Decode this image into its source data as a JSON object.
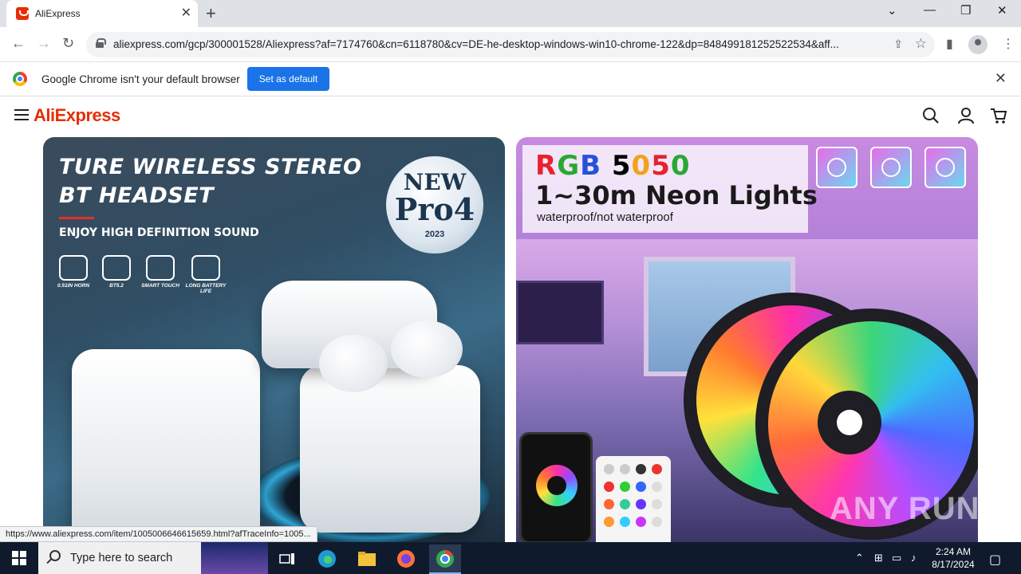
{
  "browser": {
    "tab_title": "AliExpress",
    "tab_close": "✕",
    "new_tab": "+",
    "url": "aliexpress.com/gcp/300001528/Aliexpress?af=7174760&cn=6118780&cv=DE-he-desktop-windows-win10-chrome-122&dp=848499181252522534&aff...",
    "window_controls": {
      "minimize": "—",
      "restore": "❐",
      "close": "✕",
      "tab_search": "⌄"
    }
  },
  "infobar": {
    "message": "Google Chrome isn't your default browser",
    "button": "Set as default",
    "close": "✕"
  },
  "site": {
    "logo": "AliExpress",
    "icons": [
      "menu-icon",
      "search-icon",
      "account-icon",
      "cart-icon"
    ]
  },
  "banner1": {
    "headline1": "TURE WIRELESS STEREO",
    "headline2": "BT HEADSET",
    "subline": "ENJOY HIGH DEFINITION SOUND",
    "badge_line1": "NEW",
    "badge_line2": "Pro4",
    "badge_year": "2023",
    "features": [
      "0.51IN HORN",
      "BT5.2",
      "SMART TOUCH",
      "LONG BATTERY LIFE"
    ]
  },
  "banner2": {
    "rgb_text": "RGB 5050",
    "headline": "1~30m Neon Lights",
    "subline": "waterproof/not waterproof",
    "icons": [
      "brightness-icon",
      "diy-icon",
      "timer-icon"
    ]
  },
  "status_url": "https://www.aliexpress.com/item/1005006646615659.html?afTraceInfo=1005...",
  "watermark": "ANY RUN",
  "taskbar": {
    "search_placeholder": "Type here to search",
    "time": "2:24 AM",
    "date": "8/17/2024"
  },
  "colors": {
    "brand": "#e62e04",
    "chrome_blue": "#1a73e8",
    "taskbar": "#0f1b2d"
  }
}
